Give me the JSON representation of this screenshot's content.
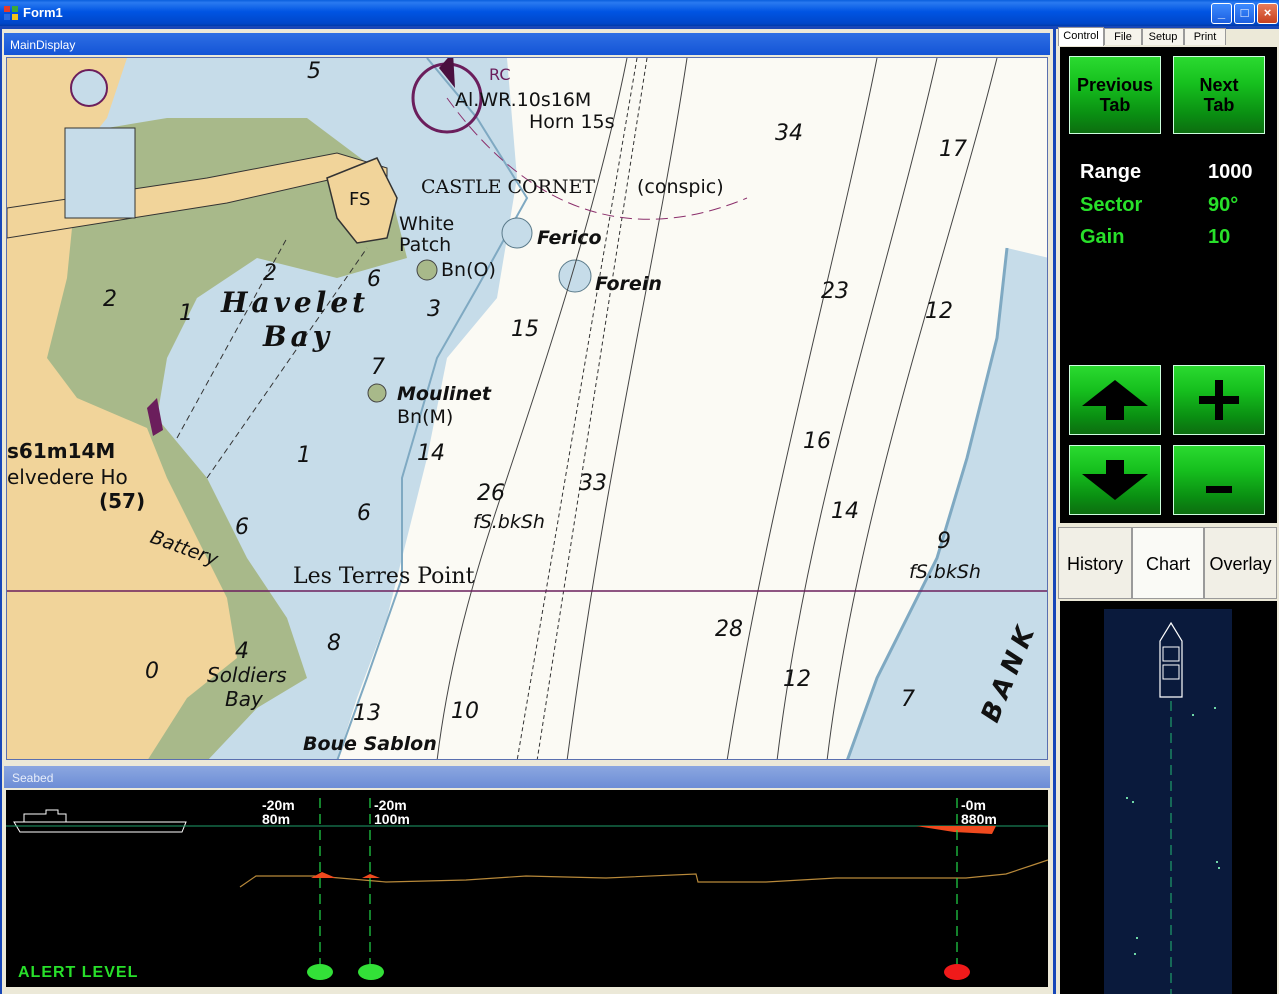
{
  "window": {
    "title": "Form1"
  },
  "main_display": {
    "title": "MainDisplay"
  },
  "seabed": {
    "title": "Seabed",
    "alert_label": "ALERT LEVEL",
    "markers": [
      {
        "depth": "-20m",
        "distance": "80m",
        "status": "green"
      },
      {
        "depth": "-20m",
        "distance": "100m",
        "status": "green"
      },
      {
        "depth": "-0m",
        "distance": "880m",
        "status": "red"
      }
    ]
  },
  "tabs": [
    "Control",
    "File",
    "Setup",
    "Print"
  ],
  "controls": {
    "prev_tab": "Previous Tab",
    "next_tab": "Next Tab",
    "range_label": "Range",
    "range_value": "1000",
    "sector_label": "Sector",
    "sector_value": "90°",
    "gain_label": "Gain",
    "gain_value": "10",
    "up_icon": "arrow-up-icon",
    "down_icon": "arrow-down-icon",
    "plus_label": "+",
    "minus_label": "-"
  },
  "view_tabs": [
    "History",
    "Chart",
    "Overlay"
  ],
  "chart_labels": {
    "castle": "CASTLE CORNET",
    "conspic": "(conspic)",
    "light": "Al.WR.10s16M",
    "horn": "Horn 15s",
    "rc": "RC",
    "ferico": "Ferico",
    "forein": "Forein",
    "havelet1": "Havelet",
    "havelet2": "Bay",
    "moulinet": "Moulinet",
    "moulinet_bn": "Bn(M)",
    "bn_o": "Bn(O)",
    "white": "White",
    "patch": "Patch",
    "terres": "Les Terres Point",
    "soldiers": "Soldiers",
    "soldiers_bay": "Bay",
    "boue": "Boue Sablon",
    "battery": "Battery",
    "belvedere": "elvedere Ho",
    "s61": "s61m14M",
    "p57": "(57)",
    "bank": "BANK",
    "fsbksh": "fS.bkSh",
    "fs": "FS"
  },
  "colors": {
    "land": "#F1D49A",
    "green": "#A8B98A",
    "shallow": "#C6DCE9",
    "sea": "#FBFAF4",
    "purple": "#6B1E5C",
    "button_green": "#16C01E",
    "sector_green": "#28E02A"
  }
}
